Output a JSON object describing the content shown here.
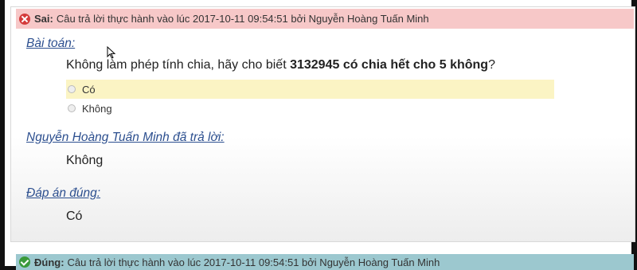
{
  "status": {
    "label": "Sai:",
    "text": "Câu trả lời thực hành vào lúc 2017-10-11 09:54:51 bởi Nguyễn Hoàng Tuấn Minh",
    "color": "#f7c8c8"
  },
  "problem": {
    "heading": "Bài toán:",
    "question_prefix": "Không làm phép tính chia, hãy cho biết ",
    "question_bold": "3132945 có chia hết cho 5 không",
    "question_suffix": "?",
    "options": [
      {
        "label": "Có",
        "highlighted": true
      },
      {
        "label": "Không",
        "highlighted": false
      }
    ]
  },
  "student_answer": {
    "heading": "Nguyễn Hoàng Tuấn Minh đã trả lời:",
    "value": "Không"
  },
  "correct_answer": {
    "heading": "Đáp án đúng:",
    "value": "Có"
  },
  "next_status": {
    "label": "Đúng:",
    "text": "Câu trả lời thực hành vào lúc 2017-10-11 09:54:51 bởi Nguyễn Hoàng Tuấn Minh",
    "color": "#9cc8cf"
  }
}
